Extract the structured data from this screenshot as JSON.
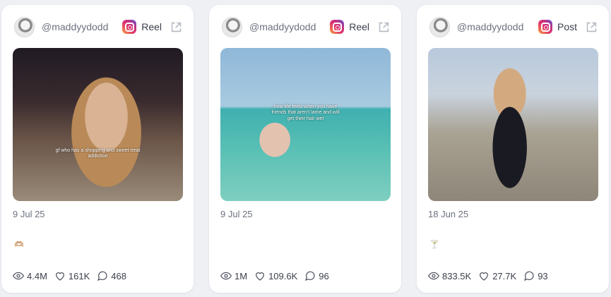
{
  "cards": [
    {
      "handle": "@maddyydodd",
      "post_type": "Reel",
      "caption_overlay": "gf who has a shopping and sweet treat addiction",
      "date": "9 Jul 25",
      "emoji": "🫶🏼",
      "views": "4.4M",
      "likes": "161K",
      "comments": "468"
    },
    {
      "handle": "@maddyydodd",
      "post_type": "Reel",
      "caption_overlay": "how life feels when you have friends that aren't lame and will get their hair wet",
      "date": "9 Jul 25",
      "emoji": "",
      "views": "1M",
      "likes": "109.6K",
      "comments": "96"
    },
    {
      "handle": "@maddyydodd",
      "post_type": "Post",
      "caption_overlay": "",
      "date": "18 Jun 25",
      "emoji": "🍸",
      "views": "833.5K",
      "likes": "27.7K",
      "comments": "93"
    }
  ],
  "icons": {
    "platform": "instagram-icon",
    "external": "external-link-icon",
    "views": "eye-icon",
    "likes": "heart-icon",
    "comments": "comment-icon"
  }
}
